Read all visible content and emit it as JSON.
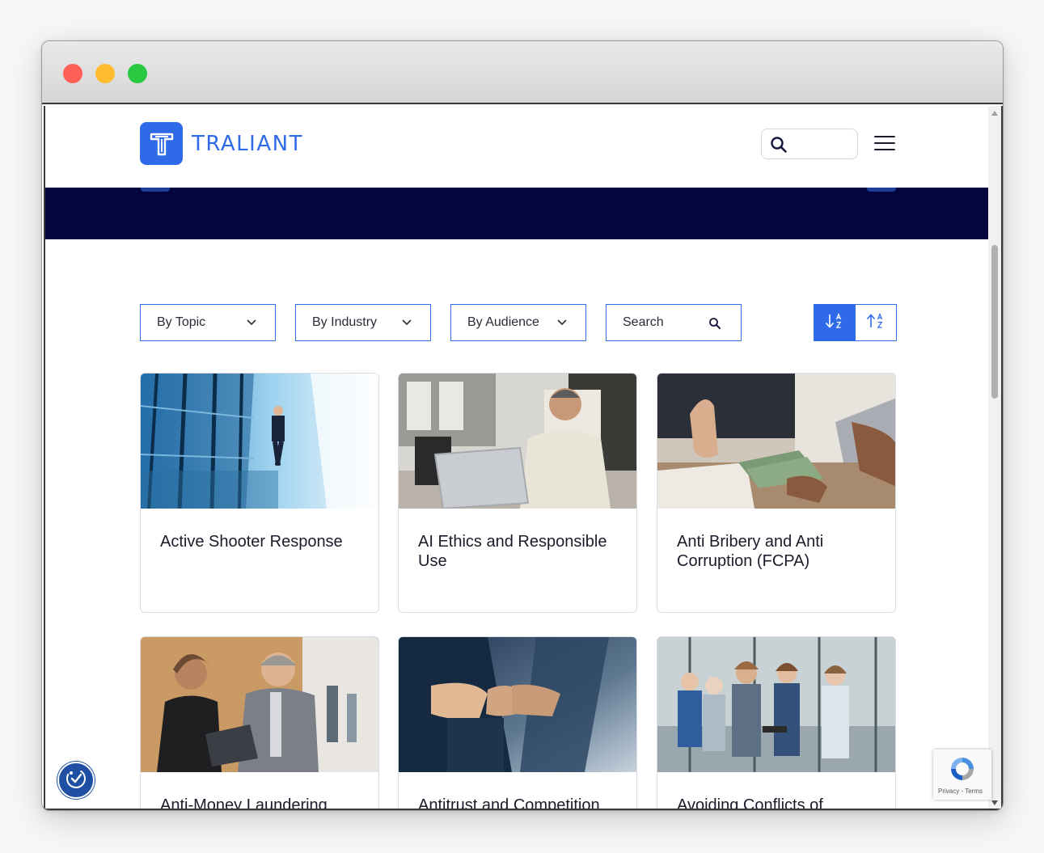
{
  "brand": {
    "name": "TRALIANT",
    "color": "#2f6be8"
  },
  "header": {
    "search_placeholder": "",
    "menu_icon": "hamburger-icon"
  },
  "hero": {
    "background": "#04043f"
  },
  "filters": {
    "topic_label": "By Topic",
    "industry_label": "By Industry",
    "audience_label": "By Audience",
    "search_placeholder": "Search",
    "sort_asc_icon": "sort-a-z-icon",
    "sort_desc_icon": "sort-z-a-icon"
  },
  "courses": [
    {
      "title": "Active Shooter Response"
    },
    {
      "title": "AI Ethics and Responsible Use"
    },
    {
      "title": "Anti Bribery and Anti Corruption (FCPA)"
    },
    {
      "title": "Anti-Money Laundering"
    },
    {
      "title": "Antitrust and Competition"
    },
    {
      "title": "Avoiding Conflicts of"
    }
  ],
  "recaptcha": {
    "terms": "Privacy - Terms"
  }
}
